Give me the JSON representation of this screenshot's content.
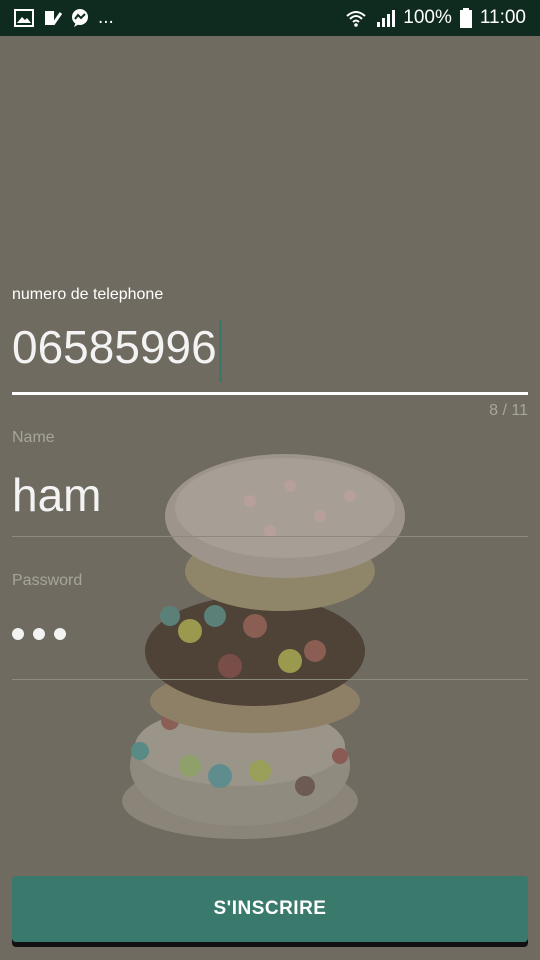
{
  "status_bar": {
    "left_icons": [
      "gallery-icon",
      "check-list-icon",
      "messenger-icon"
    ],
    "more": "...",
    "battery": "100%",
    "time": "11:00"
  },
  "form": {
    "phone": {
      "label": "numero de telephone",
      "value": "06585996",
      "counter": "8 / 11"
    },
    "name": {
      "label": "Name",
      "value": "ham"
    },
    "password": {
      "label": "Password",
      "masked_length": 3
    }
  },
  "button": {
    "label": "S'INSCRIRE"
  },
  "colors": {
    "accent": "#3a7a6c",
    "status_bar": "#0f2a1f",
    "background": "#6f6b60"
  }
}
